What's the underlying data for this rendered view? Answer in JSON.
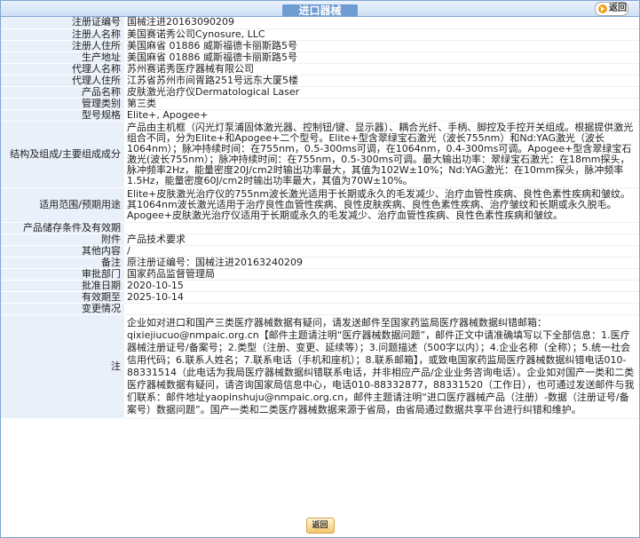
{
  "header": {
    "title": "进口器械",
    "back_label": "返回"
  },
  "fields": {
    "reg_no": {
      "k": "注册证编号",
      "v": "国械注进20163090209"
    },
    "registrant": {
      "k": "注册人名称",
      "v": "美国赛诺秀公司Cynosure, LLC"
    },
    "registrant_addr": {
      "k": "注册人住所",
      "v": "美国麻省 01886 威斯福德卡丽斯路5号"
    },
    "prod_addr": {
      "k": "生产地址",
      "v": "美国麻省 01886 威斯福德卡丽斯路5号"
    },
    "agent": {
      "k": "代理人名称",
      "v": "苏州赛诺秀医疗器械有限公司"
    },
    "agent_addr": {
      "k": "代理人住所",
      "v": "江苏省苏州市间胥路251号远东大厦5楼"
    },
    "product": {
      "k": "产品名称",
      "v": "皮肤激光治疗仪Dermatological Laser"
    },
    "category": {
      "k": "管理类别",
      "v": "第三类"
    },
    "model": {
      "k": "型号规格",
      "v": "Elite+, Apogee+"
    },
    "structure": {
      "k": "结构及组成/主要组成成分",
      "v": "产品由主机框（闪光灯泵浦固体激光器、控制钮/键、显示器）、耦合光纤、手柄、脚控及手控开关组成。根据提供激光组合不同，分为Elite+和Apogee+二个型号。Elite+型含翠绿宝石激光（波长755nm）和Nd:YAG激光（波长1064nm）；脉冲持续时间：在755nm，0.5-300ms可调，在1064nm，0.4-300ms可调。Apogee+型含翠绿宝石激光(波长755nm）；脉冲持续时间：在755nm，0.5-300ms可调。最大输出功率：翠绿宝石激光：在18mm探头，脉冲频率2Hz，能量密度20J/cm2时输出功率最大，其值为102W±10%；Nd:YAG激光：在10mm探头，脉冲频率1.5Hz，能量密度60J/cm2时输出功率最大，其值为70W±10%。"
    },
    "scope": {
      "k": "适用范围/预期用途",
      "v": "Elite+皮肤激光治疗仪的755nm波长激光适用于长期或永久的毛发减少、治疗血管性疾病、良性色素性疾病和皱纹。其1064nm波长激光适用于治疗良性血管性疾病、良性皮肤疾病、良性色素性疾病、治疗皱纹和长期或永久脱毛。Apogee+皮肤激光治疗仪适用于长期或永久的毛发减少、治疗血管性疾病、良性色素性疾病和皱纹。"
    },
    "storage": {
      "k": "产品储存条件及有效期",
      "v": ""
    },
    "attachment": {
      "k": "附件",
      "v": "产品技术要求"
    },
    "other": {
      "k": "其他内容",
      "v": "/"
    },
    "remark": {
      "k": "备注",
      "v": "原注册证编号：国械注进20163240209"
    },
    "dept": {
      "k": "审批部门",
      "v": "国家药品监督管理局"
    },
    "approve_date": {
      "k": "批准日期",
      "v": "2020-10-15"
    },
    "valid_to": {
      "k": "有效期至",
      "v": "2025-10-14"
    },
    "change": {
      "k": "变更情况",
      "v": ""
    },
    "note": {
      "k": "注",
      "v": "企业如对进口和国产三类医疗器械数据有疑问，请发送邮件至国家药监局医疗器械数据纠错邮箱：qixiejiucuo@nmpaic.org.cn【邮件主题请注明“医疗器械数据问题”，邮件正文中请准确填写以下全部信息：1.医疗器械注册证号/备案号；2.类型（注册、变更、延续等）；3.问题描述（500字以内）；4.企业名称（全称）；5.统一社会信用代码；6.联系人姓名；7.联系电话（手机和座机）；8.联系邮箱】，或致电国家药监局医疗器械数据纠错电话010-88331514（此电话为我局医疗器械数据纠错联系电话，并非相应产品/企业业务咨询电话）。企业如对国产一类和二类医疗器械数据有疑问，请咨询国家局信息中心，电话010-88332877，88331520（工作日），也可通过发送邮件与我们联系：邮件地址yaopinshuju@nmpaic.org.cn，邮件主题请注明“进口医疗器械产品（注册）-数据（注册证号/备案号）数据问题”。国产一类和二类医疗器械数据来源于省局，由省局通过数据共享平台进行纠错和维护。"
    }
  },
  "footer": {
    "back_label": "返回"
  },
  "colors": {
    "label_bg": "#e9f0f9",
    "border": "#7fa7d6",
    "accent": "#f0a020"
  }
}
